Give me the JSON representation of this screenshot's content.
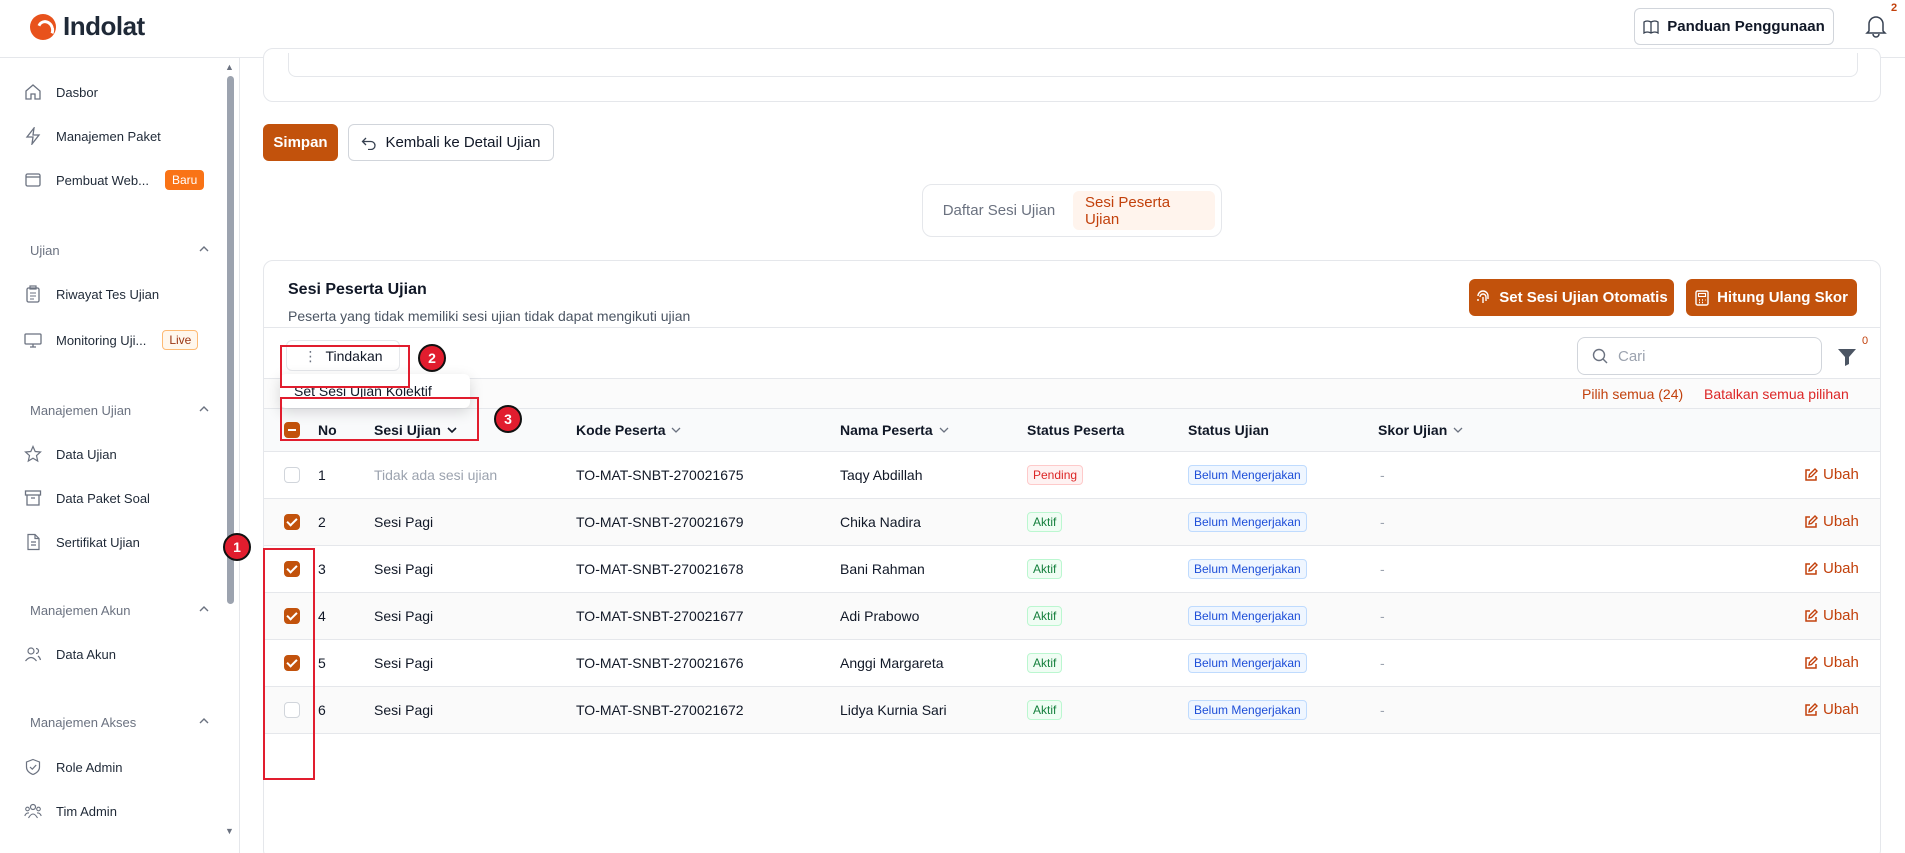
{
  "app": {
    "logo_text": "Indolat"
  },
  "header": {
    "guide_label": "Panduan Penggunaan",
    "notification_count": "2"
  },
  "sidebar": {
    "items_top": [
      {
        "label": "Dasbor",
        "icon": "home-icon"
      },
      {
        "label": "Manajemen Paket",
        "icon": "lightning-icon"
      },
      {
        "label": "Pembuat Web...",
        "icon": "window-icon",
        "badge": "Baru"
      }
    ],
    "sections": [
      {
        "title": "Ujian",
        "items": [
          {
            "label": "Riwayat Tes Ujian",
            "icon": "clipboard-icon"
          },
          {
            "label": "Monitoring Uji...",
            "icon": "monitor-icon",
            "badge": "Live"
          }
        ]
      },
      {
        "title": "Manajemen Ujian",
        "items": [
          {
            "label": "Data Ujian",
            "icon": "star-icon"
          },
          {
            "label": "Data Paket Soal",
            "icon": "archive-icon"
          },
          {
            "label": "Sertifikat Ujian",
            "icon": "document-icon"
          }
        ]
      },
      {
        "title": "Manajemen Akun",
        "items": [
          {
            "label": "Data Akun",
            "icon": "users-icon"
          }
        ]
      },
      {
        "title": "Manajemen Akses",
        "items": [
          {
            "label": "Role Admin",
            "icon": "shield-icon"
          },
          {
            "label": "Tim Admin",
            "icon": "team-icon"
          }
        ]
      }
    ]
  },
  "actions": {
    "save_label": "Simpan",
    "back_label": "Kembali ke Detail Ujian"
  },
  "tabs": [
    {
      "label": "Daftar Sesi Ujian",
      "active": false
    },
    {
      "label": "Sesi Peserta Ujian",
      "active": true
    }
  ],
  "panel": {
    "title": "Sesi Peserta Ujian",
    "subtitle": "Peserta yang tidak memiliki sesi ujian tidak dapat mengikuti ujian",
    "auto_label": "Set Sesi Ujian Otomatis",
    "recalc_label": "Hitung Ulang Skor",
    "actions_label": "Tindakan",
    "search_placeholder": "Cari",
    "filter_count": "0",
    "select_all": "Pilih semua (24)",
    "cancel_all": "Batalkan semua pilihan",
    "dropdown_item": "Set Sesi Ujian Kolektif"
  },
  "table": {
    "headers": [
      "No",
      "Sesi Ujian",
      "Kode Peserta",
      "Nama Peserta",
      "Status Peserta",
      "Status Ujian",
      "Skor Ujian"
    ],
    "edit_label": "Ubah",
    "rows": [
      {
        "no": "1",
        "session": "Tidak ada sesi ujian",
        "code": "TO-MAT-SNBT-270021675",
        "name": "Taqy Abdillah",
        "status": "Pending",
        "exam_status": "Belum Mengerjakan",
        "score": "-",
        "checked": false
      },
      {
        "no": "2",
        "session": "Sesi Pagi",
        "code": "TO-MAT-SNBT-270021679",
        "name": "Chika Nadira",
        "status": "Aktif",
        "exam_status": "Belum Mengerjakan",
        "score": "-",
        "checked": true
      },
      {
        "no": "3",
        "session": "Sesi Pagi",
        "code": "TO-MAT-SNBT-270021678",
        "name": "Bani Rahman",
        "status": "Aktif",
        "exam_status": "Belum Mengerjakan",
        "score": "-",
        "checked": true
      },
      {
        "no": "4",
        "session": "Sesi Pagi",
        "code": "TO-MAT-SNBT-270021677",
        "name": "Adi Prabowo",
        "status": "Aktif",
        "exam_status": "Belum Mengerjakan",
        "score": "-",
        "checked": true
      },
      {
        "no": "5",
        "session": "Sesi Pagi",
        "code": "TO-MAT-SNBT-270021676",
        "name": "Anggi Margareta",
        "status": "Aktif",
        "exam_status": "Belum Mengerjakan",
        "score": "-",
        "checked": true
      },
      {
        "no": "6",
        "session": "Sesi Pagi",
        "code": "TO-MAT-SNBT-270021672",
        "name": "Lidya Kurnia Sari",
        "status": "Aktif",
        "exam_status": "Belum Mengerjakan",
        "score": "-",
        "checked": false
      }
    ]
  },
  "annotations": [
    "1",
    "2",
    "3"
  ],
  "colors": {
    "accent": "#c2520c",
    "annotation": "#e11d2e"
  }
}
